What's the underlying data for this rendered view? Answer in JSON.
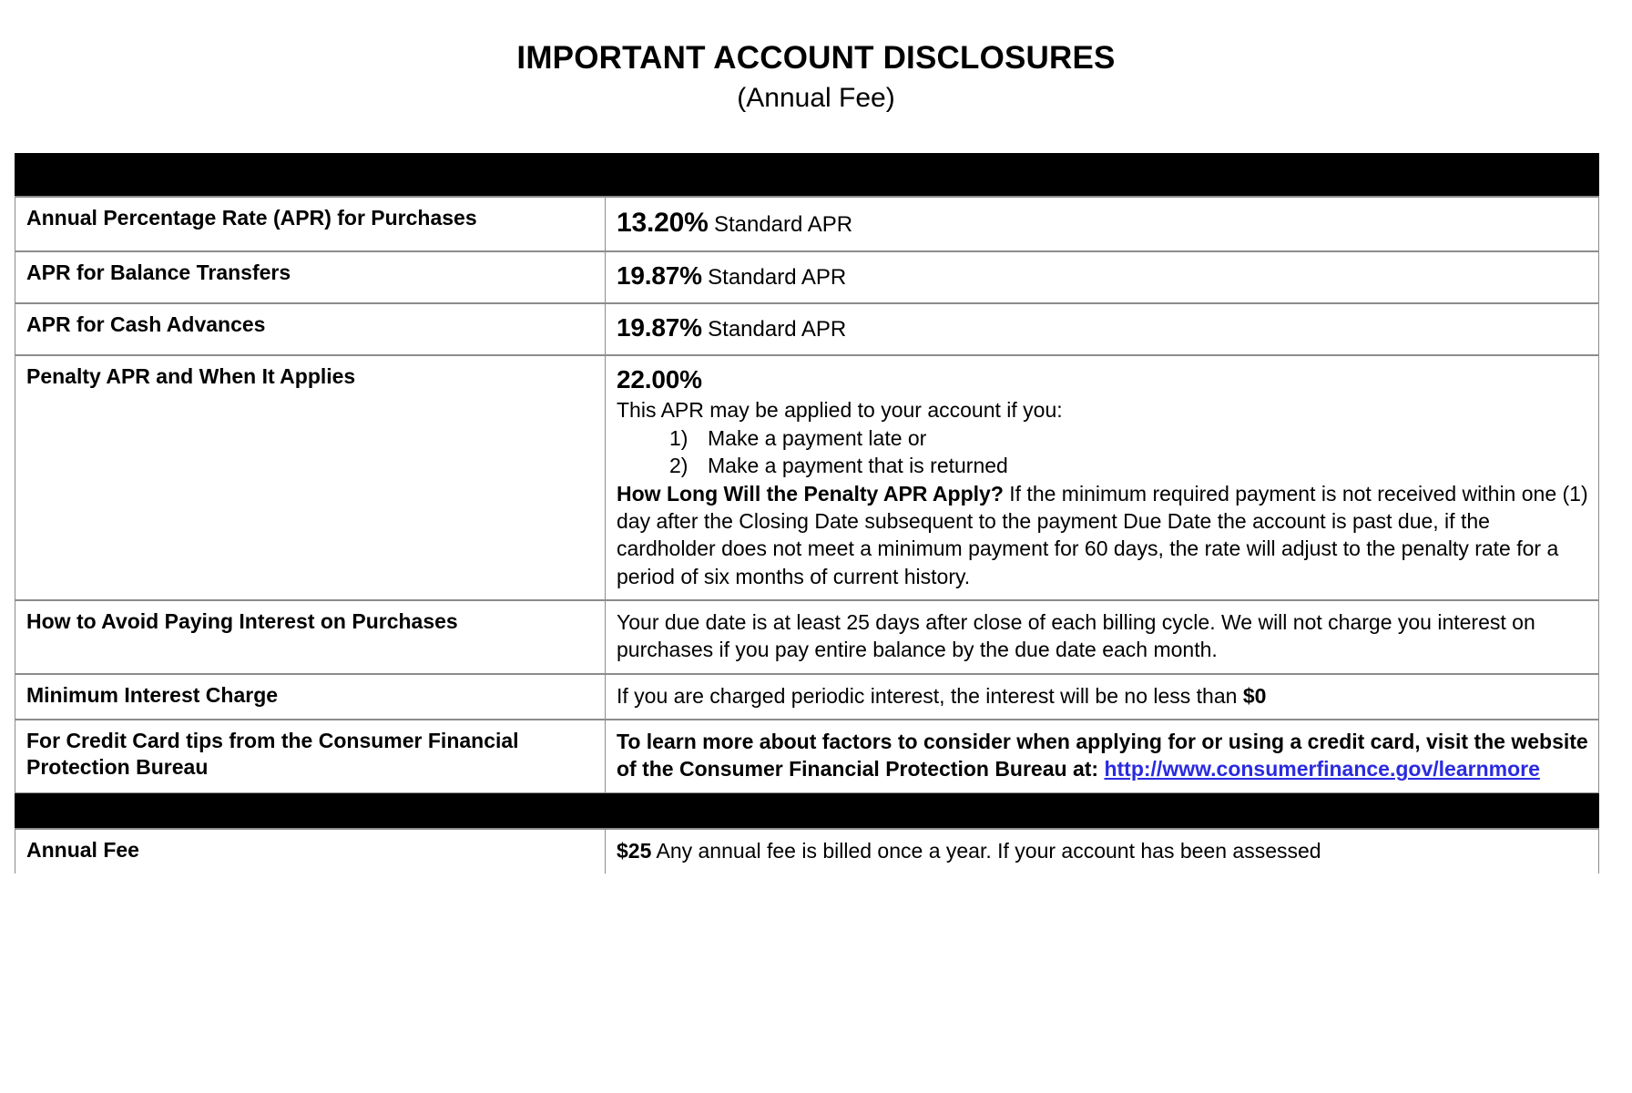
{
  "document": {
    "title": "IMPORTANT ACCOUNT DISCLOSURES",
    "subtitle": "(Annual Fee)"
  },
  "colors": {
    "header_bar": "#000000",
    "link": "#2a2ae0",
    "border": "#8c8c8c",
    "text": "#000000"
  },
  "table": {
    "rows": {
      "apr_purchases": {
        "label": "Annual Percentage Rate (APR) for Purchases",
        "rate": "13.20%",
        "note": "Standard APR"
      },
      "apr_balance_transfers": {
        "label": "APR for Balance Transfers",
        "rate": "19.87%",
        "note": "Standard APR"
      },
      "apr_cash_advances": {
        "label": "APR for Cash Advances",
        "rate": "19.87%",
        "note": "Standard APR"
      },
      "penalty_apr": {
        "label": "Penalty APR and When It Applies",
        "rate": "22.00%",
        "intro": "This APR may be applied to your account if you:",
        "conditions": [
          {
            "num": "1)",
            "text": "Make a payment late or"
          },
          {
            "num": "2)",
            "text": "Make a payment that is returned"
          }
        ],
        "duration_heading": "How Long Will the Penalty APR Apply?",
        "duration_text": "If the minimum required payment is not received within one (1) day after the Closing Date subsequent to the payment Due Date the account is past due, if the cardholder does not meet a minimum payment for 60 days, the rate will adjust to the penalty rate for a period of six months of current history."
      },
      "avoid_interest": {
        "label": "How to Avoid Paying Interest on Purchases",
        "text": "Your due date is at least 25 days after close of each billing cycle. We will not charge you interest on purchases if you pay entire balance by the due date each month."
      },
      "minimum_interest": {
        "label": "Minimum Interest Charge",
        "text_before": "If you are charged periodic interest, the interest will be no less than ",
        "amount": "$0"
      },
      "cfpb_tips": {
        "label": "For Credit Card tips from the Consumer Financial Protection Bureau",
        "text": "To learn more about factors to consider when applying for or using a credit card, visit the website of the Consumer Financial Protection Bureau at: ",
        "link_text": "http://www.consumerfinance.gov/learnmore"
      },
      "annual_fee": {
        "label": "Annual Fee",
        "amount": "$25",
        "text": " Any annual fee is billed once a year. If your account has been assessed"
      }
    }
  }
}
